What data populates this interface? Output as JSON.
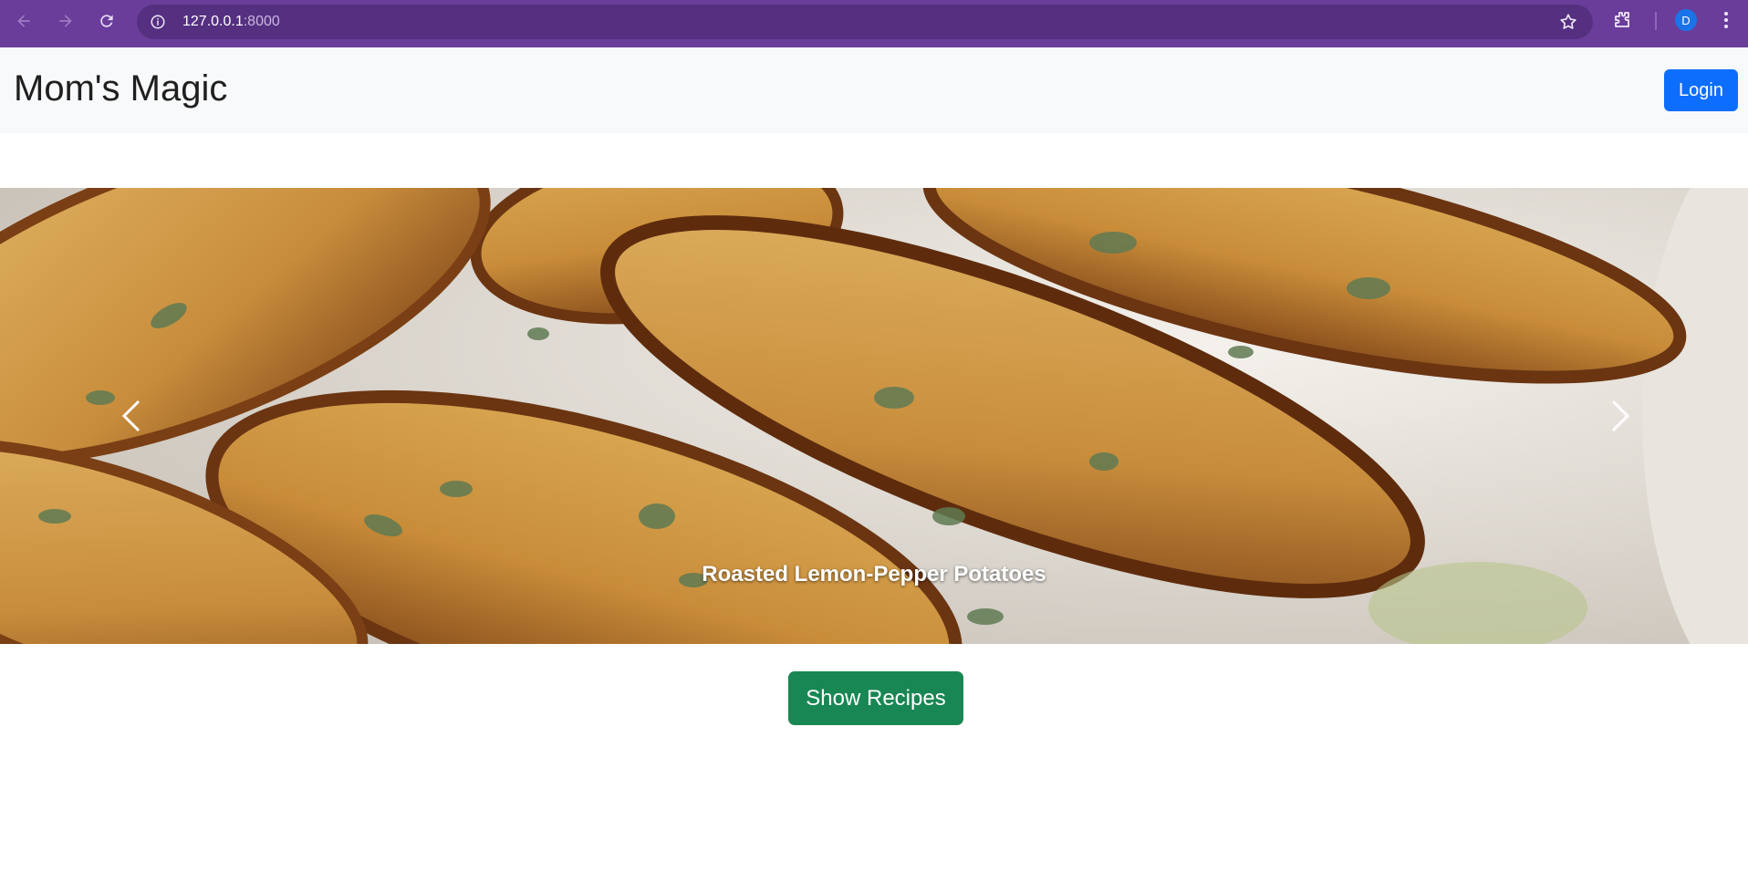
{
  "browser": {
    "url_host": "127.0.0.1",
    "url_port": ":8000",
    "profile_initial": "D"
  },
  "navbar": {
    "brand": "Mom's Magic",
    "login_label": "Login"
  },
  "carousel": {
    "caption": "Roasted Lemon-Pepper Potatoes",
    "prev_icon": "chevron-left-icon",
    "next_icon": "chevron-right-icon"
  },
  "main": {
    "show_recipes_label": "Show Recipes"
  },
  "colors": {
    "browser_frame": "#6a3d9a",
    "primary": "#0d6efd",
    "success": "#198754",
    "navbar_bg": "#f8f9fa"
  }
}
